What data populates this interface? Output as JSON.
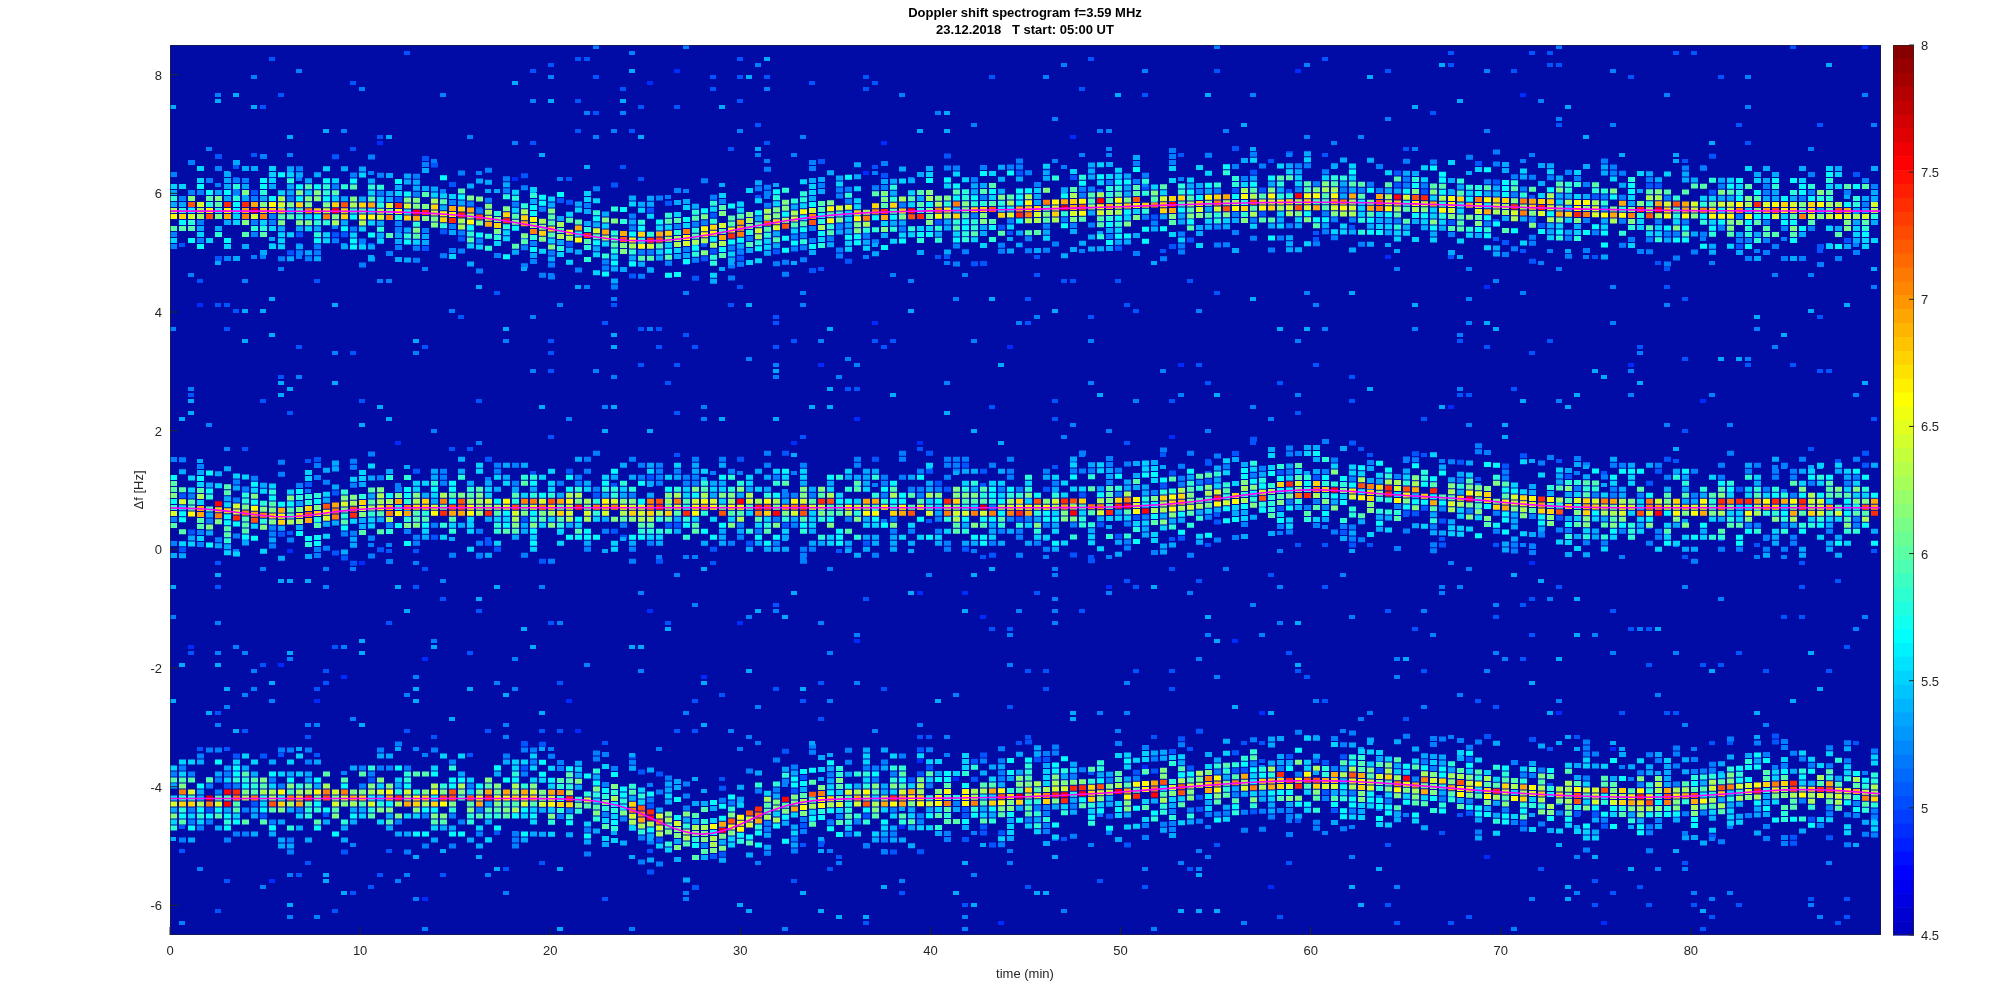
{
  "figure": {
    "title_lines": [
      "Doppler shift spectrogram f=3.59 MHz",
      "23.12.2018   T start: 05:00 UT"
    ],
    "xlabel": "time (min)",
    "ylabel": "Δf [Hz]",
    "xticks": [
      "0",
      "10",
      "20",
      "30",
      "40",
      "50",
      "60",
      "70",
      "80"
    ],
    "yticks": [
      "8",
      "6",
      "4",
      "2",
      "0",
      "-2",
      "-4",
      "-6"
    ],
    "colorbar": {
      "ticks": [
        "8",
        "7.5",
        "7",
        "6.5",
        "6",
        "5.5",
        "5",
        "4.5"
      ]
    }
  }
}
